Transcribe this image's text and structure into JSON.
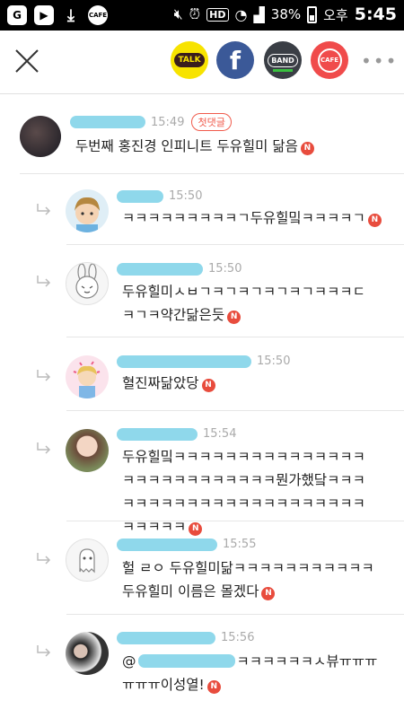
{
  "status_bar": {
    "left_icons": [
      "g-app-icon",
      "play-icon",
      "download-icon",
      "cafe-icon"
    ],
    "hd": "HD",
    "battery": "38%",
    "ampm": "오후",
    "time": "5:45"
  },
  "header": {
    "share_kakao_label": "TALK",
    "share_facebook_label": "f",
    "share_band_label": "BAND",
    "share_cafe_label": "CAFE",
    "more_label": "•••"
  },
  "comments": [
    {
      "time": "15:49",
      "badge": "첫댓글",
      "text": "두번째 홍진경 인피니트 두유힐미 닮음",
      "n": "N"
    },
    {
      "time": "15:50",
      "text": "ㅋㅋㅋㅋㅋㅋㅋㅋㅋㄱ두유힐밐ㅋㅋㅋㅋㄱ",
      "n": "N"
    },
    {
      "time": "15:50",
      "text": "두유힐미ㅅㅂㄱㅋㄱㅋㄱㅋㄱㅋㄱㅋㅋㅋㄷㅋㄱㅋ약간닮은듯",
      "n": "N"
    },
    {
      "time": "15:50",
      "text": "혈진짜닮았당",
      "n": "N"
    },
    {
      "time": "15:54",
      "text": "두유힐밐ㅋㅋㅋㅋㅋㅋㅋㅋㅋㅋㅋㅋㅋㅋㅋㅋㅋㅋㅋㅋㅋㅋㅋㅋㅋㅋㅋ뭔가했닼ㅋㅋㅋㅋㅋㅋㅋㅋㅋㅋㅋㅋㅋㅋㅋㅋㅋㅋㅋㅋㅋㅋㅋㅋㅋㅋㅋ",
      "n": "N"
    },
    {
      "time": "15:55",
      "text": "헐 ㄹㅇ 두유힐미닮ㅋㅋㅋㅋㅋㅋㅋㅋㅋㅋㅋ 두유힐미 이름은 몰겠다",
      "n": "N"
    },
    {
      "time": "15:56",
      "text_prefix": "@",
      "text": "ㅋㅋㅋㅋㅋㅋㅅ뷰ㅠㅠㅠㅠㅠㅠ이성열!",
      "n": "N"
    }
  ]
}
